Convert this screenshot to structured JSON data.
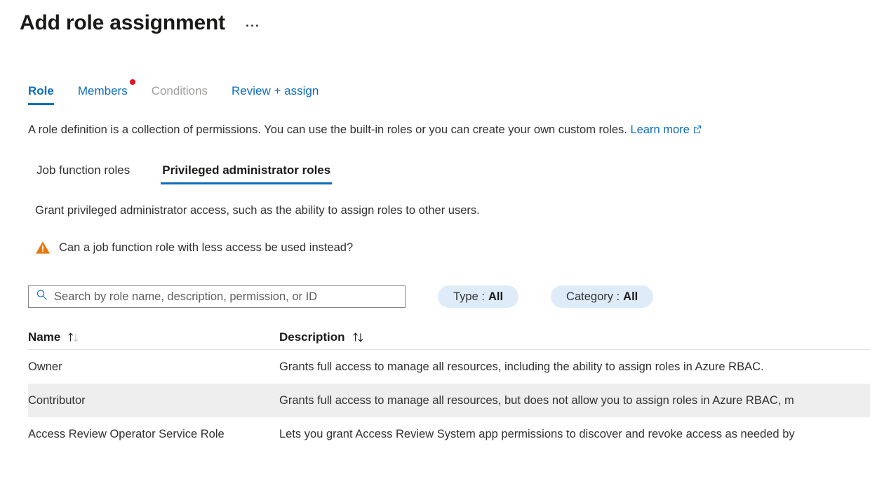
{
  "header": {
    "title": "Add role assignment",
    "more_label": "More commands"
  },
  "tabs": [
    {
      "label": "Role",
      "state": "active",
      "badge": false
    },
    {
      "label": "Members",
      "state": "enabled",
      "badge": true
    },
    {
      "label": "Conditions",
      "state": "disabled",
      "badge": false
    },
    {
      "label": "Review + assign",
      "state": "enabled",
      "badge": false
    }
  ],
  "description": {
    "text": "A role definition is a collection of permissions. You can use the built-in roles or you can create your own custom roles. ",
    "link_text": "Learn more",
    "link_icon": "external-link-icon"
  },
  "subtabs": [
    {
      "label": "Job function roles",
      "state": "enabled"
    },
    {
      "label": "Privileged administrator roles",
      "state": "active"
    }
  ],
  "subdescription": "Grant privileged administrator access, such as the ability to assign roles to other users.",
  "warning": {
    "icon": "warning-triangle-icon",
    "text": "Can a job function role with less access be used instead?"
  },
  "search": {
    "icon": "search-icon",
    "placeholder": "Search by role name, description, permission, or ID",
    "value": ""
  },
  "filters": [
    {
      "label": "Type :",
      "value": "All"
    },
    {
      "label": "Category :",
      "value": "All"
    }
  ],
  "table": {
    "columns": [
      {
        "key": "name",
        "label": "Name",
        "sort_icon": "sort-updown-icon"
      },
      {
        "key": "description",
        "label": "Description",
        "sort_icon": "sort-updown-icon"
      }
    ],
    "rows": [
      {
        "name": "Owner",
        "description": "Grants full access to manage all resources, including the ability to assign roles in Azure RBAC.",
        "selected": false
      },
      {
        "name": "Contributor",
        "description": "Grants full access to manage all resources, but does not allow you to assign roles in Azure RBAC, m",
        "selected": true
      },
      {
        "name": "Access Review Operator Service Role",
        "description": "Lets you grant Access Review System app permissions to discover and revoke access as needed by",
        "selected": false
      }
    ]
  },
  "colors": {
    "accent_blue": "#0f6cbd",
    "badge_red": "#e81123",
    "warning_orange": "#e8770a",
    "pill_bg": "#deecf9",
    "row_selected_bg": "#efeeee",
    "text_primary": "#323130",
    "text_disabled": "#a19f9d"
  }
}
